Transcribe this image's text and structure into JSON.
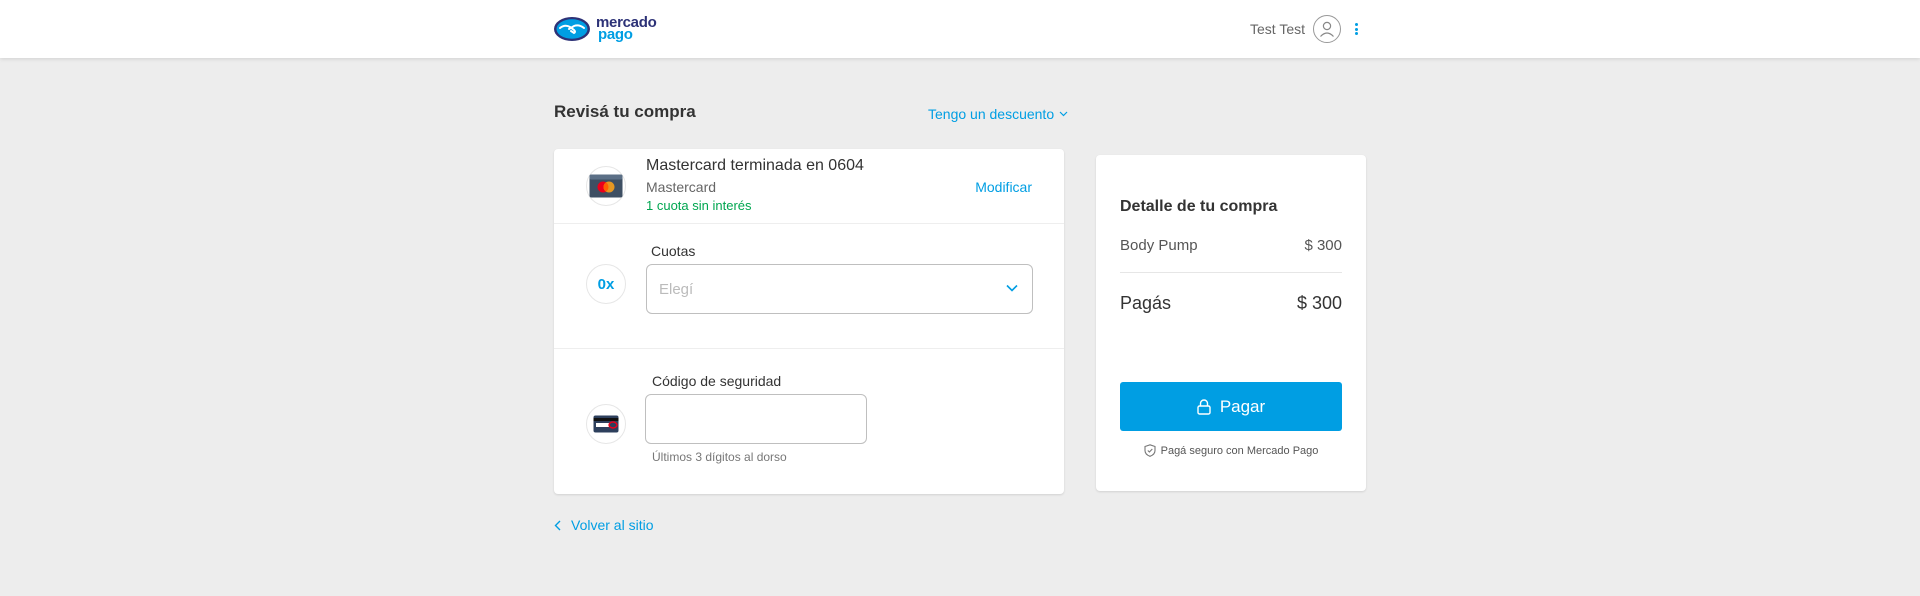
{
  "header": {
    "logo_line1": "mercado",
    "logo_line2": "pago",
    "user_name": "Test Test",
    "avatar_icon": "user-icon",
    "menu_icon": "kebab-menu-icon"
  },
  "main": {
    "title": "Revisá tu compra",
    "discount_link": "Tengo un descuento",
    "payment_method": {
      "title": "Mastercard terminada en 0604",
      "brand": "Mastercard",
      "installments_note": "1 cuota sin interés",
      "modify_label": "Modificar"
    },
    "installments": {
      "icon_text": "0x",
      "label": "Cuotas",
      "placeholder": "Elegí"
    },
    "security_code": {
      "label": "Código de seguridad",
      "value": "",
      "hint": "Últimos 3 dígitos al dorso"
    },
    "back_link": "Volver al sitio"
  },
  "summary": {
    "title": "Detalle de tu compra",
    "item_name": "Body Pump",
    "item_price": "$ 300",
    "total_label": "Pagás",
    "total_price": "$ 300",
    "pay_button": "Pagar",
    "secure_note": "Pagá seguro con Mercado Pago"
  },
  "colors": {
    "accent": "#009ee3",
    "brand_dark": "#2d3277",
    "success": "#00a650",
    "background": "#ededed"
  }
}
